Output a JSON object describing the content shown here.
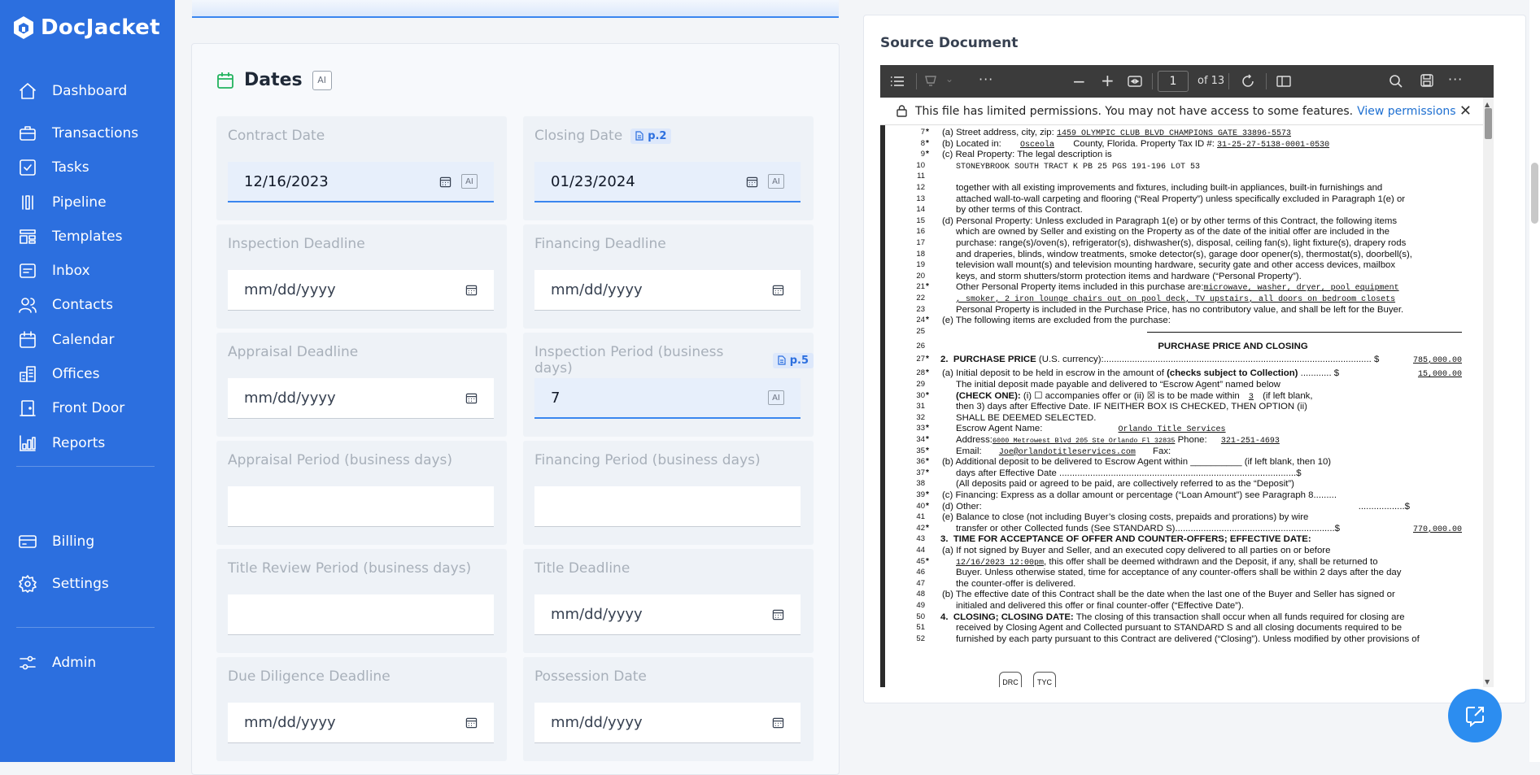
{
  "app": {
    "name": "DocJacket"
  },
  "sidebar": {
    "items": [
      {
        "label": "Dashboard",
        "icon": "home-icon"
      },
      {
        "label": "Transactions",
        "icon": "briefcase-icon"
      },
      {
        "label": "Tasks",
        "icon": "checkbox-icon"
      },
      {
        "label": "Pipeline",
        "icon": "pipeline-icon"
      },
      {
        "label": "Templates",
        "icon": "templates-icon"
      },
      {
        "label": "Inbox",
        "icon": "inbox-icon"
      },
      {
        "label": "Contacts",
        "icon": "contacts-icon"
      },
      {
        "label": "Calendar",
        "icon": "calendar-icon"
      },
      {
        "label": "Offices",
        "icon": "offices-icon"
      },
      {
        "label": "Front Door",
        "icon": "door-icon"
      },
      {
        "label": "Reports",
        "icon": "reports-icon"
      }
    ],
    "bottom_items": [
      {
        "label": "Billing",
        "icon": "billing-icon"
      },
      {
        "label": "Settings",
        "icon": "gear-icon"
      }
    ],
    "admin": {
      "label": "Admin",
      "icon": "sliders-icon"
    }
  },
  "dates": {
    "title": "Dates",
    "ai_label": "AI",
    "fields": [
      {
        "label": "Contract Date",
        "value": "12/16/2023",
        "placeholder": "mm/dd/yyyy",
        "filled": true,
        "page": ""
      },
      {
        "label": "Closing Date",
        "value": "01/23/2024",
        "placeholder": "mm/dd/yyyy",
        "filled": true,
        "page": "p.2"
      },
      {
        "label": "Inspection Deadline",
        "value": "",
        "placeholder": "mm/dd/yyyy",
        "filled": false,
        "page": ""
      },
      {
        "label": "Financing Deadline",
        "value": "",
        "placeholder": "mm/dd/yyyy",
        "filled": false,
        "page": ""
      },
      {
        "label": "Appraisal Deadline",
        "value": "",
        "placeholder": "mm/dd/yyyy",
        "filled": false,
        "page": ""
      },
      {
        "label": "Inspection Period (business days)",
        "value": "7",
        "placeholder": "",
        "filled": true,
        "page": "p.5"
      },
      {
        "label": "Appraisal Period (business days)",
        "value": "",
        "placeholder": "",
        "filled": false,
        "page": ""
      },
      {
        "label": "Financing Period (business days)",
        "value": "",
        "placeholder": "",
        "filled": false,
        "page": ""
      },
      {
        "label": "Title Review Period (business days)",
        "value": "",
        "placeholder": "",
        "filled": false,
        "page": ""
      },
      {
        "label": "Title Deadline",
        "value": "",
        "placeholder": "mm/dd/yyyy",
        "filled": false,
        "page": ""
      },
      {
        "label": "Due Diligence Deadline",
        "value": "",
        "placeholder": "mm/dd/yyyy",
        "filled": false,
        "page": ""
      },
      {
        "label": "Possession Date",
        "value": "",
        "placeholder": "mm/dd/yyyy",
        "filled": false,
        "page": ""
      }
    ]
  },
  "source": {
    "title": "Source Document",
    "viewer": {
      "page_current": "1",
      "page_total": "of 13",
      "notice": "This file has limited permissions. You may not have access to some features.",
      "notice_link": "View permissions"
    },
    "document": {
      "l7_label": "(a) Street address, city, zip:",
      "l7_value": "1459   OLYMPIC CLUB BLVD                    CHAMPIONS GATE    33896-5573",
      "l8_label": "(b) Located in:",
      "l8_county": "Osceola",
      "l8_mid": "County, Florida. Property Tax ID #:",
      "l8_tax": "31-25-27-5138-0001-0530",
      "l9": "(c) Real Property: The legal description is",
      "l10": "STONEYBROOK SOUTH TRACT K PB 25 PGS 191-196 LOT 53",
      "l12": "together with all existing improvements and fixtures, including built-in appliances, built-in furnishings and",
      "l13": "attached wall-to-wall carpeting and flooring (“Real Property”) unless specifically excluded in Paragraph 1(e) or",
      "l14": "by other terms of this Contract.",
      "l15": "(d) Personal Property: Unless excluded in Paragraph 1(e) or by other terms of this Contract, the following items",
      "l16": "which are owned by Seller and existing on the Property as of the date of the initial offer are included in the",
      "l17": "purchase: range(s)/oven(s), refrigerator(s), dishwasher(s), disposal, ceiling fan(s), light fixture(s), drapery rods",
      "l18": "and draperies, blinds, window treatments, smoke detector(s), garage door opener(s), thermostat(s), doorbell(s),",
      "l19": "television wall mount(s) and television mounting hardware, security gate and other access devices, mailbox",
      "l20": "keys, and storm shutters/storm protection items and hardware (“Personal Property”).",
      "l21_label": "Other Personal Property items included in this purchase are:",
      "l21_value": "microwave, washer, dryer, pool equipment",
      "l22": ", smoker, 2 iron lounge chairs out on pool deck, TV upstairs, all doors on bedroom closets",
      "l23": "Personal Property is included in the Purchase Price, has no contributory value, and shall be left for the Buyer.",
      "l24": "(e) The following items are excluded from the purchase:",
      "heading": "PURCHASE PRICE AND CLOSING",
      "l27_num": "2.",
      "l27_label": "PURCHASE PRICE",
      "l27_rest": "(U.S. currency):........................................................................................................ $",
      "l27_value": "785,000.00",
      "l28_label": "(a) Initial deposit to be held in escrow in the amount of",
      "l28_bold": "(checks subject to Collection)",
      "l28_dots": "............ $",
      "l28_value": "15,000.00",
      "l29": "The initial deposit made payable and delivered to “Escrow Agent” named below",
      "l30_bold": "(CHECK ONE):",
      "l30_a": "(i) ☐ accompanies offer or (ii) ☒ is to be made within",
      "l30_days": "3",
      "l30_b": "(if left blank,",
      "l31": "then 3) days after Effective Date. IF NEITHER BOX IS CHECKED, THEN OPTION (ii)",
      "l32": "SHALL BE DEEMED SELECTED.",
      "l33_label": "Escrow Agent Name:",
      "l33_value": "Orlando Title Services",
      "l34_label": "Address:",
      "l34_value": "6000 Metrowest Blvd 205 Ste Orlando  Fl  32835",
      "l34_phone_label": "Phone:",
      "l34_phone": "321-251-4693",
      "l35_label": "Email:",
      "l35_value": "Joe@orlandotitleservices.com",
      "l35_fax": "Fax:",
      "l36": "(b) Additional deposit to be delivered to Escrow Agent within __________ (if left blank, then 10)",
      "l37": "days after Effective Date ............................................................................................$",
      "l38": "(All deposits paid or agreed to be paid, are collectively referred to as the “Deposit”)",
      "l39": "(c) Financing: Express as a dollar amount or percentage (“Loan Amount”) see Paragraph 8.........",
      "l40": "(d) Other:",
      "l40_r": "..................$",
      "l41": "(e) Balance to close (not including Buyer’s closing costs, prepaids and prorations) by wire",
      "l42": "transfer or other Collected funds (See STANDARD S)..............................................................$",
      "l42_value": "770,000.00",
      "l43_num": "3.",
      "l43": "TIME FOR ACCEPTANCE OF OFFER AND COUNTER-OFFERS; EFFECTIVE DATE:",
      "l44": "(a) If not signed by Buyer and Seller, and an executed copy delivered to all parties on or before",
      "l45_value": "12/16/2023    12:00pm",
      "l45": ", this offer shall be deemed withdrawn and the Deposit, if any, shall be returned to",
      "l46": "Buyer. Unless otherwise stated, time for acceptance of any counter-offers shall be within 2 days after the day",
      "l47": "the counter-offer is delivered.",
      "l48": "(b) The effective date of this Contract shall be the date when the last one of the Buyer and Seller has signed or",
      "l49": "initialed and delivered this offer or final counter-offer (“Effective Date”).",
      "l50_num": "4.",
      "l50_bold": "CLOSING; CLOSING DATE:",
      "l50": "The closing of this transaction shall occur when all funds required for closing are",
      "l51": "received by Closing Agent and Collected pursuant to STANDARD S and all closing documents required to be",
      "l52": "furnished by each party pursuant to this Contract are delivered (“Closing”).  Unless modified by other provisions of",
      "initials_1": "DRC",
      "initials_2": "TYC"
    }
  },
  "colors": {
    "sidebar": "#2c6fdf",
    "accent": "#3a86ef",
    "badge": "#dde8fb",
    "chat": "#2c8df0"
  }
}
